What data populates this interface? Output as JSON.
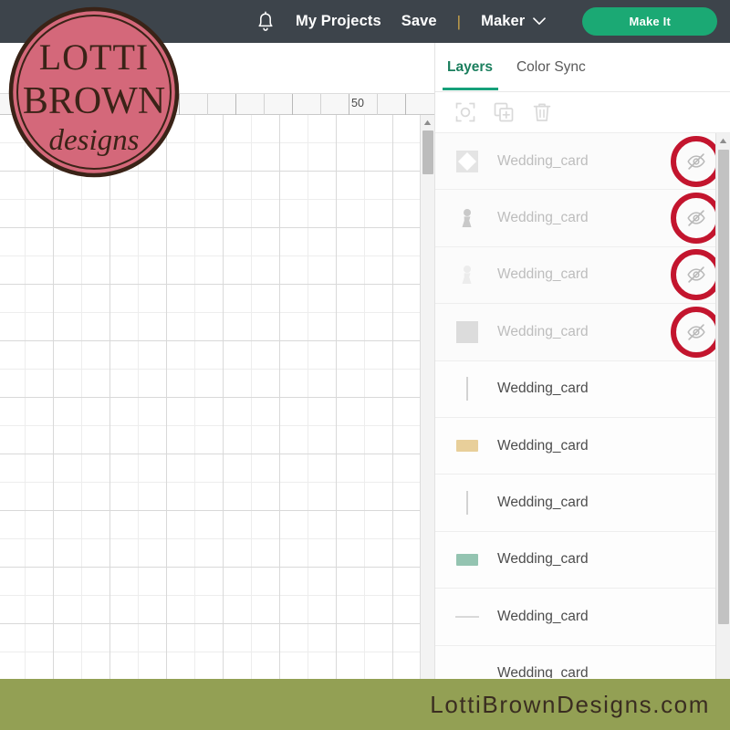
{
  "topnav": {
    "bell_icon": "bell-icon",
    "my_projects": "My Projects",
    "save": "Save",
    "divider": "|",
    "machine": "Maker",
    "chevron_icon": "chevron-down-icon",
    "make_it": "Make It",
    "bg_color": "#3d444b",
    "make_it_color": "#1ba974"
  },
  "canvas": {
    "ruler_label": "50",
    "scroll_up_icon": "caret-up-icon"
  },
  "panel": {
    "tabs": [
      {
        "label": "Layers",
        "active": true
      },
      {
        "label": "Color Sync",
        "active": false
      }
    ],
    "accent_color": "#16a07a",
    "tools": [
      {
        "name": "group-select-icon"
      },
      {
        "name": "duplicate-icon"
      },
      {
        "name": "delete-icon"
      }
    ],
    "scroll_up_icon": "caret-up-icon",
    "annotation_color": "#c3152e",
    "layers": [
      {
        "name": "Wedding_card",
        "hidden": true,
        "annotated": true,
        "thumb": "diamond",
        "color": "#e4e4e4"
      },
      {
        "name": "Wedding_card",
        "hidden": true,
        "annotated": true,
        "thumb": "pawn",
        "color": "#c9c9c9"
      },
      {
        "name": "Wedding_card",
        "hidden": true,
        "annotated": true,
        "thumb": "pawn",
        "color": "#ececec"
      },
      {
        "name": "Wedding_card",
        "hidden": true,
        "annotated": true,
        "thumb": "square",
        "color": "#dcdcdc"
      },
      {
        "name": "Wedding_card",
        "hidden": false,
        "annotated": false,
        "thumb": "vline",
        "color": "#d3d3d3"
      },
      {
        "name": "Wedding_card",
        "hidden": false,
        "annotated": false,
        "thumb": "rect",
        "color": "#e8cf9a"
      },
      {
        "name": "Wedding_card",
        "hidden": false,
        "annotated": false,
        "thumb": "vline",
        "color": "#d3d3d3"
      },
      {
        "name": "Wedding_card",
        "hidden": false,
        "annotated": false,
        "thumb": "rect",
        "color": "#94c4b1"
      },
      {
        "name": "Wedding_card",
        "hidden": false,
        "annotated": false,
        "thumb": "hline",
        "color": "#d9d9d9"
      },
      {
        "name": "Wedding_card",
        "hidden": false,
        "annotated": false,
        "thumb": "none",
        "color": "#dddddd"
      }
    ]
  },
  "watermark": {
    "line1": "LOTTI",
    "line2": "BROWN",
    "line3": "designs",
    "circle_color": "#d4687a",
    "text_color": "#3a2317"
  },
  "footer": {
    "text": "LottiBrownDesigns.com",
    "bg_color": "#93a054",
    "text_color": "#3a2d21"
  }
}
